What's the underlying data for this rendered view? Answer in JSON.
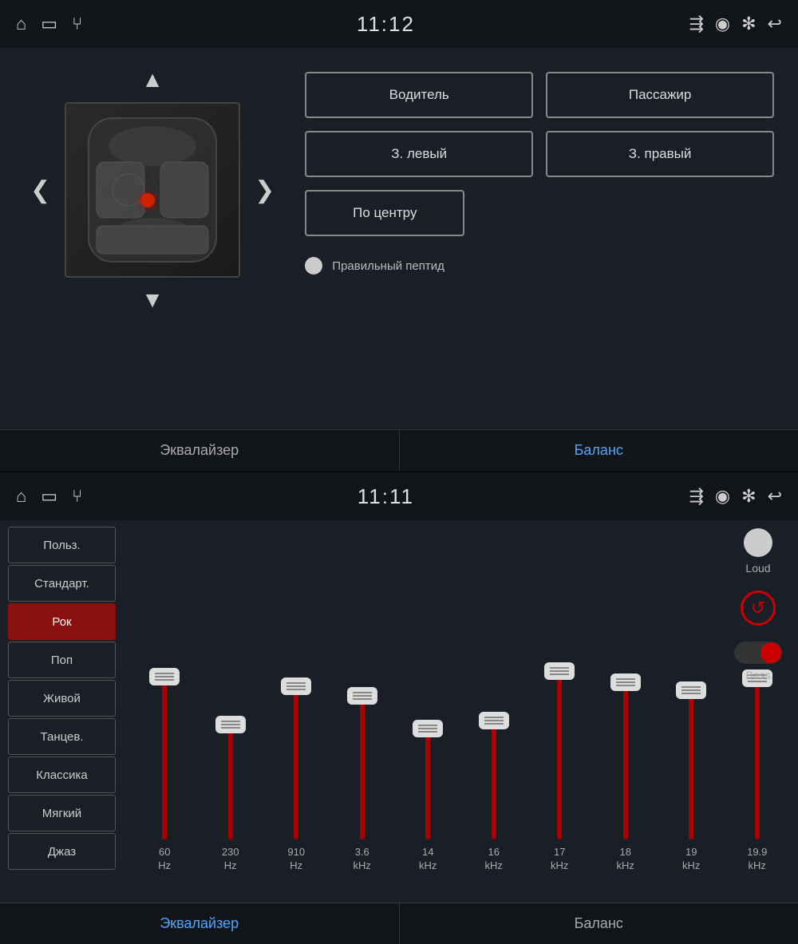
{
  "top_status_bar": {
    "time": "11:12",
    "icons_left": [
      "home-icon",
      "tv-icon",
      "usb-icon"
    ],
    "icons_right": [
      "cast-icon",
      "location-icon",
      "bluetooth-icon",
      "back-icon"
    ]
  },
  "seat_panel": {
    "up_arrow": "▲",
    "left_arrow": "❮",
    "right_arrow": "❯",
    "down_arrow": "▼",
    "buttons": [
      {
        "label": "Водитель",
        "id": "driver"
      },
      {
        "label": "Пассажир",
        "id": "passenger"
      },
      {
        "label": "З. левый",
        "id": "rear-left"
      },
      {
        "label": "З. правый",
        "id": "rear-right"
      },
      {
        "label": "По центру",
        "id": "center"
      }
    ],
    "peptide_label": "Правильный пептид"
  },
  "top_tabs": [
    {
      "label": "Эквалайзер",
      "active": false
    },
    {
      "label": "Баланс",
      "active": true
    }
  ],
  "bottom_status_bar": {
    "time": "11:11"
  },
  "eq_presets": [
    {
      "label": "Польз.",
      "active": false
    },
    {
      "label": "Стандарт.",
      "active": false
    },
    {
      "label": "Рок",
      "active": true
    },
    {
      "label": "Поп",
      "active": false
    },
    {
      "label": "Живой",
      "active": false
    },
    {
      "label": "Танцев.",
      "active": false
    },
    {
      "label": "Классика",
      "active": false
    },
    {
      "label": "Мягкий",
      "active": false
    },
    {
      "label": "Джаз",
      "active": false
    }
  ],
  "eq_bands": [
    {
      "freq": "60",
      "unit": "Hz",
      "level": 0.85
    },
    {
      "freq": "230",
      "unit": "Hz",
      "level": 0.6
    },
    {
      "freq": "910",
      "unit": "Hz",
      "level": 0.8
    },
    {
      "freq": "3.6",
      "unit": "kHz",
      "level": 0.75
    },
    {
      "freq": "14",
      "unit": "kHz",
      "level": 0.58
    },
    {
      "freq": "16",
      "unit": "kHz",
      "level": 0.62
    },
    {
      "freq": "17",
      "unit": "kHz",
      "level": 0.88
    },
    {
      "freq": "18",
      "unit": "kHz",
      "level": 0.82
    },
    {
      "freq": "19",
      "unit": "kHz",
      "level": 0.78
    },
    {
      "freq": "19.9",
      "unit": "kHz",
      "level": 0.84
    }
  ],
  "eq_controls": {
    "loud_label": "Loud",
    "reset_icon": "↺",
    "bass_label": "Bass"
  },
  "bottom_tabs": [
    {
      "label": "Эквалайзер",
      "active": true
    },
    {
      "label": "Баланс",
      "active": false
    }
  ]
}
